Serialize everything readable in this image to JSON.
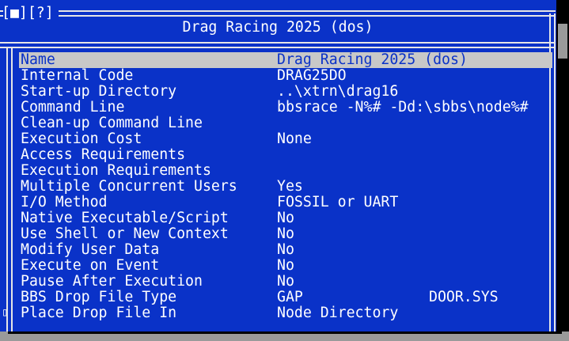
{
  "window": {
    "controls": "[■][?]",
    "title": "Drag Racing 2025 (dos)",
    "scroll_marker": "▯"
  },
  "settings": [
    {
      "label": "Name",
      "value": "Drag Racing 2025 (dos)",
      "selected": true
    },
    {
      "label": "Internal Code",
      "value": "DRAG25DO"
    },
    {
      "label": "Start-up Directory",
      "value": "..\\xtrn\\drag16"
    },
    {
      "label": "Command Line",
      "value": "bbsrace -N%# -Dd:\\sbbs\\node%#"
    },
    {
      "label": "Clean-up Command Line",
      "value": ""
    },
    {
      "label": "Execution Cost",
      "value": "None"
    },
    {
      "label": "Access Requirements",
      "value": ""
    },
    {
      "label": "Execution Requirements",
      "value": ""
    },
    {
      "label": "Multiple Concurrent Users",
      "value": "Yes"
    },
    {
      "label": "I/O Method",
      "value": "FOSSIL or UART"
    },
    {
      "label": "Native Executable/Script",
      "value": "No"
    },
    {
      "label": "Use Shell or New Context",
      "value": "No"
    },
    {
      "label": "Modify User Data",
      "value": "No"
    },
    {
      "label": "Execute on Event",
      "value": "No"
    },
    {
      "label": "Pause After Execution",
      "value": "No"
    },
    {
      "label": "BBS Drop File Type",
      "value": "GAP",
      "value2": "DOOR.SYS"
    },
    {
      "label": "Place Drop File In",
      "value": "Node Directory"
    }
  ],
  "colors": {
    "background": "#0a32c8",
    "selection": "#c8c8c8",
    "text": "#ffffff",
    "border": "#e6e6e6"
  }
}
